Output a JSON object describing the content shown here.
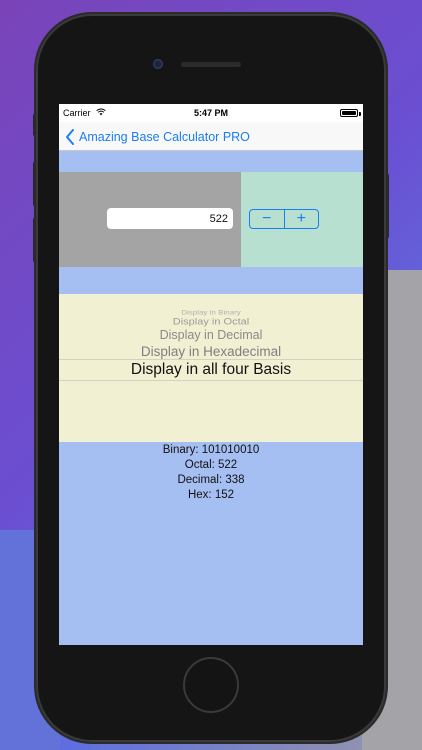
{
  "status_bar": {
    "carrier": "Carrier",
    "time": "5:47 PM"
  },
  "nav": {
    "back_label": "Amazing Base Calculator PRO"
  },
  "input": {
    "value": "522"
  },
  "stepper": {
    "minus": "−",
    "plus": "+"
  },
  "picker": {
    "options": [
      "Display in Binary",
      "Display in Octal",
      "Display in Decimal",
      "Display in Hexadecimal",
      "Display in all four Basis"
    ],
    "selected": "Display in all four Basis"
  },
  "results": {
    "binary": "Binary: 101010010",
    "octal": "Octal: 522",
    "decimal": "Decimal: 338",
    "hex": "Hex: 152"
  },
  "icons": {
    "back": "chevron-left-icon",
    "wifi": "wifi-icon",
    "battery": "battery-icon"
  },
  "colors": {
    "accent": "#1b7ef2",
    "band": "#a6bff2",
    "picker_bg": "#f1f0d3",
    "stepper_bg": "#b7e0d0",
    "input_bg": "#a4a4a4"
  }
}
